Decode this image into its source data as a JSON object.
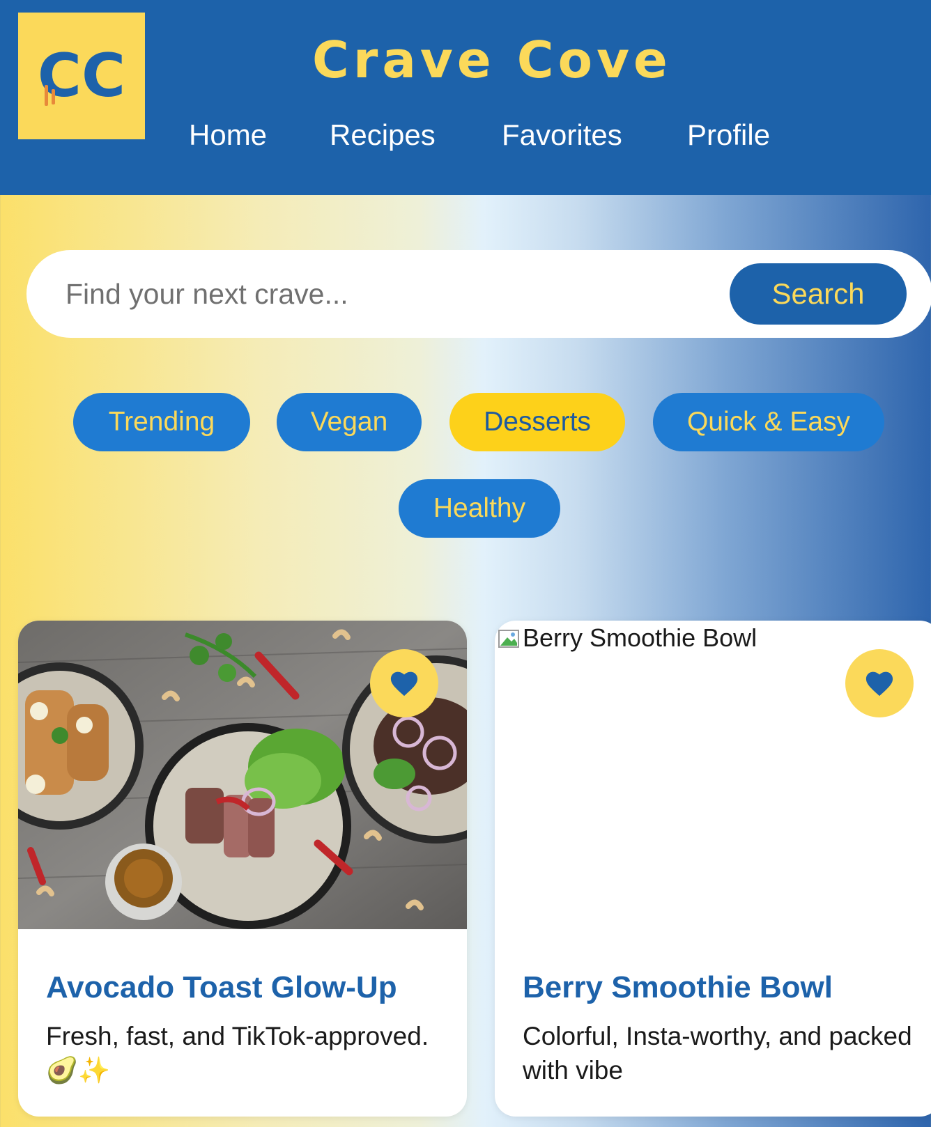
{
  "header": {
    "logo_text": "CC",
    "title": "Crave Cove",
    "nav": [
      "Home",
      "Recipes",
      "Favorites",
      "Profile"
    ]
  },
  "search": {
    "placeholder": "Find your next crave...",
    "button_label": "Search"
  },
  "filters": {
    "items": [
      "Trending",
      "Vegan",
      "Desserts",
      "Quick & Easy",
      "Healthy"
    ],
    "active": "Desserts"
  },
  "cards": [
    {
      "title": "Avocado Toast Glow-Up",
      "description": "Fresh, fast, and TikTok-approved. 🥑✨",
      "favorite_icon": "heart-icon"
    },
    {
      "image_alt": "Berry Smoothie Bowl",
      "title": "Berry Smoothie Bowl",
      "description": "Colorful, Insta-worthy, and packed with vibe",
      "favorite_icon": "heart-icon"
    }
  ],
  "colors": {
    "primary_blue": "#1d62aa",
    "accent_yellow": "#fbd95a",
    "pill_blue": "#1f7bd2",
    "active_pill": "#fdd11a"
  }
}
